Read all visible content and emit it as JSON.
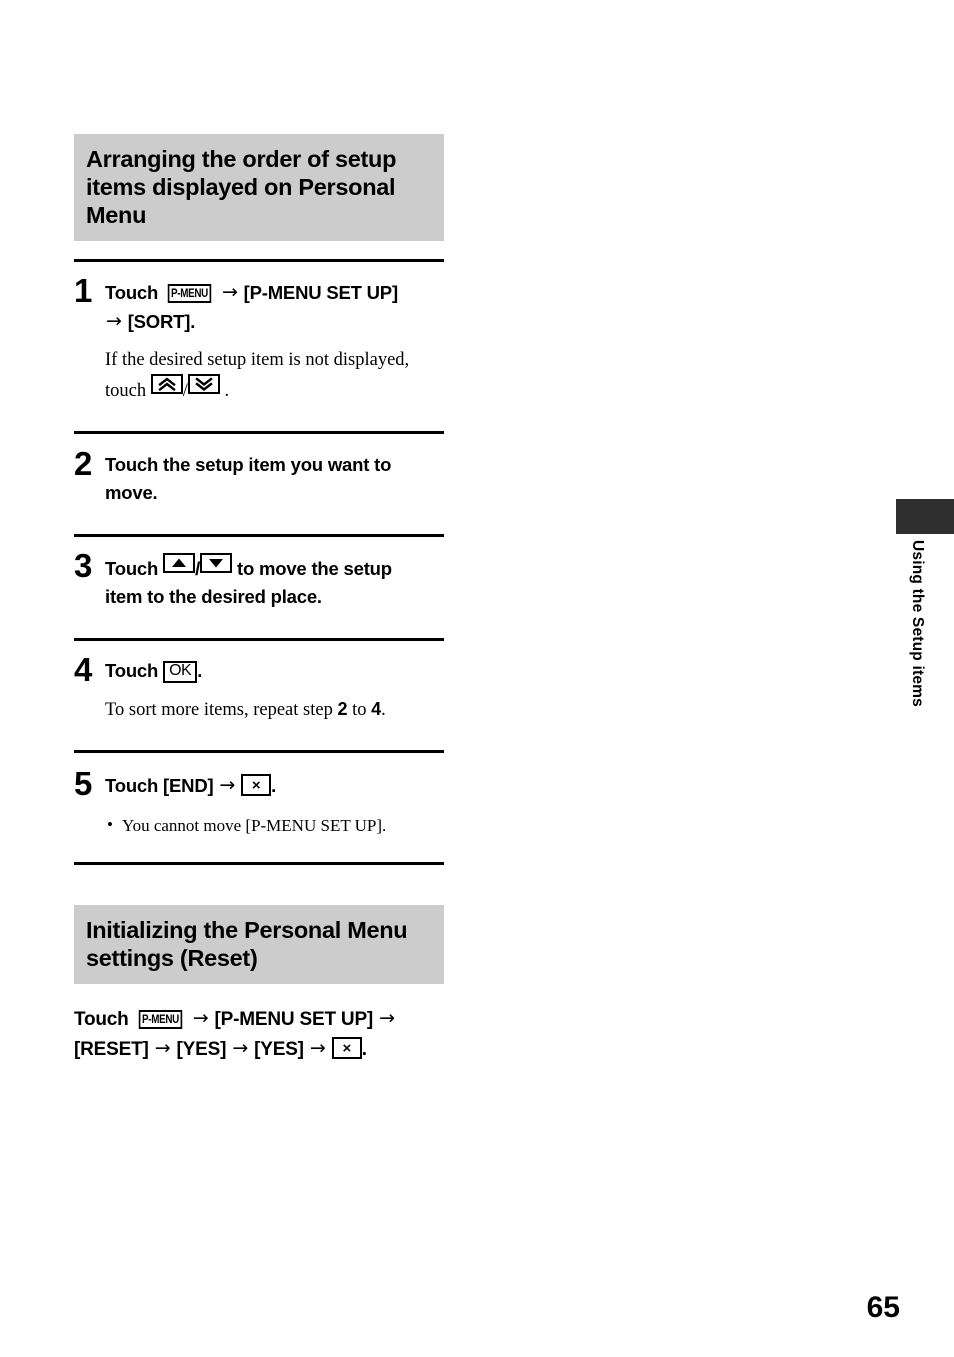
{
  "page": {
    "number": "65",
    "side_tab_label": "Using the Setup items"
  },
  "sections": [
    {
      "heading_lines": [
        "Arranging the order of setup",
        "items displayed on Personal",
        "Menu"
      ],
      "steps": [
        {
          "number": "1",
          "text_before_key": "Touch",
          "key1": "P-MENU",
          "arrow1": "→",
          "text_mid": "[P-MENU SET UP]",
          "arrow2": "→",
          "text_end": "[SORT].",
          "body_line1": "If the desired setup item is not displayed,",
          "body_touch": "touch",
          "body_sep": "/",
          "body_end": "."
        },
        {
          "number": "2",
          "text_line1": "Touch the setup item you want to",
          "text_line2": "move."
        },
        {
          "number": "3",
          "text_before_key": "Touch",
          "key_sep": "/",
          "text_after_key": "to move the setup",
          "text_line2": "item to the desired place."
        },
        {
          "number": "4",
          "text_before_key": "Touch",
          "key_ok": "OK",
          "text_after_key": ".",
          "body_pre": "To sort more items, repeat step",
          "body_step_a": "2",
          "body_to": "to",
          "body_step_b": "4",
          "body_end": "."
        },
        {
          "number": "5",
          "text_before_key": "Touch [END]",
          "arrow1": "→",
          "key_x": "×",
          "text_after_key": ".",
          "bullet_dot": "•",
          "bullet_text": "You cannot move [P-MENU SET UP]."
        }
      ]
    },
    {
      "heading_lines": [
        "Initializing the Personal Menu",
        "settings (Reset)"
      ],
      "reset": {
        "touch_label": "Touch",
        "key_pmenu": "P-MENU",
        "arrow1": "→",
        "text_setup": "[P-MENU SET UP]",
        "arrow2": "→",
        "text_reset": "[RESET]",
        "arrow3": "→",
        "text_yes1": "[YES]",
        "arrow4": "→",
        "text_yes2": "[YES]",
        "arrow5": "→",
        "key_x": "×",
        "text_end": "."
      }
    }
  ],
  "colors": {
    "heading_band": "#cccccc",
    "rule": "#000000",
    "side_tab": "#2e2e2e"
  }
}
